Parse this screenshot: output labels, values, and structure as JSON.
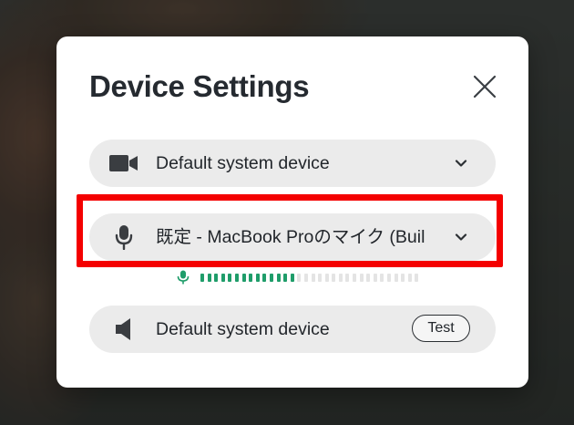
{
  "modal": {
    "title": "Device Settings",
    "close_icon": "close-icon"
  },
  "camera": {
    "icon": "video-camera-icon",
    "selected": "Default system device",
    "dropdown_icon": "chevron-down-icon"
  },
  "microphone": {
    "icon": "microphone-icon",
    "selected": "既定 - MacBook Proのマイク (Buil",
    "dropdown_icon": "chevron-down-icon",
    "level_meter": {
      "active_segments": 14,
      "total_segments": 32,
      "active_color": "#1f9d6a"
    }
  },
  "speaker": {
    "icon": "speaker-icon",
    "selected": "Default system device",
    "test_label": "Test"
  },
  "colors": {
    "highlight": "#f40000",
    "field_background": "#ebebeb",
    "meter_active": "#1f9d6a"
  }
}
